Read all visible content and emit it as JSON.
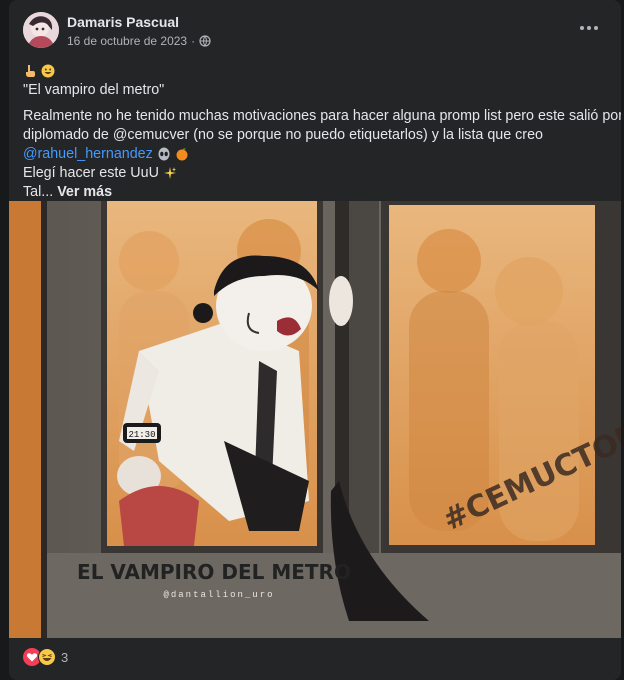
{
  "post": {
    "author": "Damaris Pascual",
    "date": "16 de octubre de 2023",
    "separator": "·",
    "privacy_icon": "globe-icon",
    "options_icon": "more-options-icon"
  },
  "content": {
    "line1_emojis": [
      "pointing-up-icon",
      "grinning-face-icon"
    ],
    "title": "\"El vampiro del metro\"",
    "body_part1": "Realmente no he tenido muchas motivaciones para hacer alguna promp list pero este salió por el",
    "body_part2": "diplomado de @cemucver (no se porque no puedo etiquetarlos)  y la lista que creo",
    "mention": "@rahuel_hernandez",
    "mention_emojis": [
      "alien-icon",
      "orange-icon"
    ],
    "line5": "Elegí hacer este UuU",
    "line5_emoji": "sparkles-icon",
    "line6": "Tal...",
    "see_more": "Ver más"
  },
  "artwork": {
    "caption": "EL VAMPIRO DEL METRO",
    "watermark": "@dantallion_uro",
    "hashtag": "#CEMUCTOBER",
    "watch_time": "21:30"
  },
  "reactions": {
    "icons": [
      "love-reaction-icon",
      "haha-reaction-icon"
    ],
    "count": "3"
  }
}
